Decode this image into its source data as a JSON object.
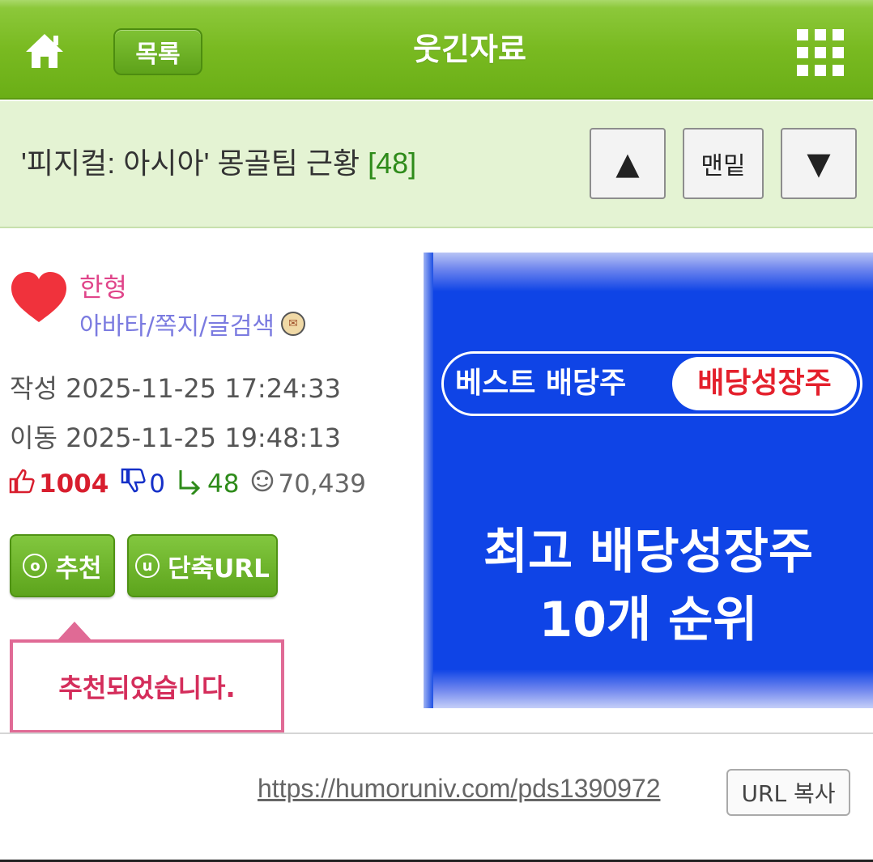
{
  "header": {
    "list_label": "목록",
    "board_title": "웃긴자료"
  },
  "post": {
    "subject": "'피지컬: 아시아' 몽골팀 근황",
    "comment_count": "[48]",
    "nav_bottom_label": "맨밑"
  },
  "author": {
    "name": "한형",
    "links": "아바타/쪽지/글검색"
  },
  "meta": {
    "created_label": "작성",
    "created_value": "2025-11-25 17:24:33",
    "moved_label": "이동",
    "moved_value": "2025-11-25 19:48:13"
  },
  "stats": {
    "upvotes": "1004",
    "downvotes": "0",
    "replies": "48",
    "views": "70,439"
  },
  "actions": {
    "recommend_key": "o",
    "recommend_label": "추천",
    "short_url_key": "u",
    "short_url_label": "단축URL"
  },
  "tooltip": {
    "message": "추천되었습니다."
  },
  "ad": {
    "pill_left": "베스트 배당주",
    "pill_right": "배당성장주",
    "headline_line1": "최고 배당성장주",
    "headline_line2": "10개 순위"
  },
  "footer": {
    "url": "https://humoruniv.com/pds1390972",
    "copy_label": "URL 복사"
  },
  "colors": {
    "header_green": "#79ba21",
    "subject_bg": "#e4f3d3",
    "upvote_red": "#d81e2e",
    "downvote_blue": "#1530c8",
    "reply_green": "#2e8b1a",
    "author_pink": "#e0458a",
    "link_purple": "#7b7be0",
    "ad_blue": "#0f44e6"
  },
  "icons": {
    "home": "home-icon",
    "grid": "grid-menu-icon",
    "up": "arrow-up-icon",
    "down": "arrow-down-icon",
    "thumb_up": "thumbs-up-icon",
    "thumb_down": "thumbs-down-icon",
    "reply": "reply-icon",
    "views": "smiley-icon",
    "mail": "mail-icon"
  }
}
